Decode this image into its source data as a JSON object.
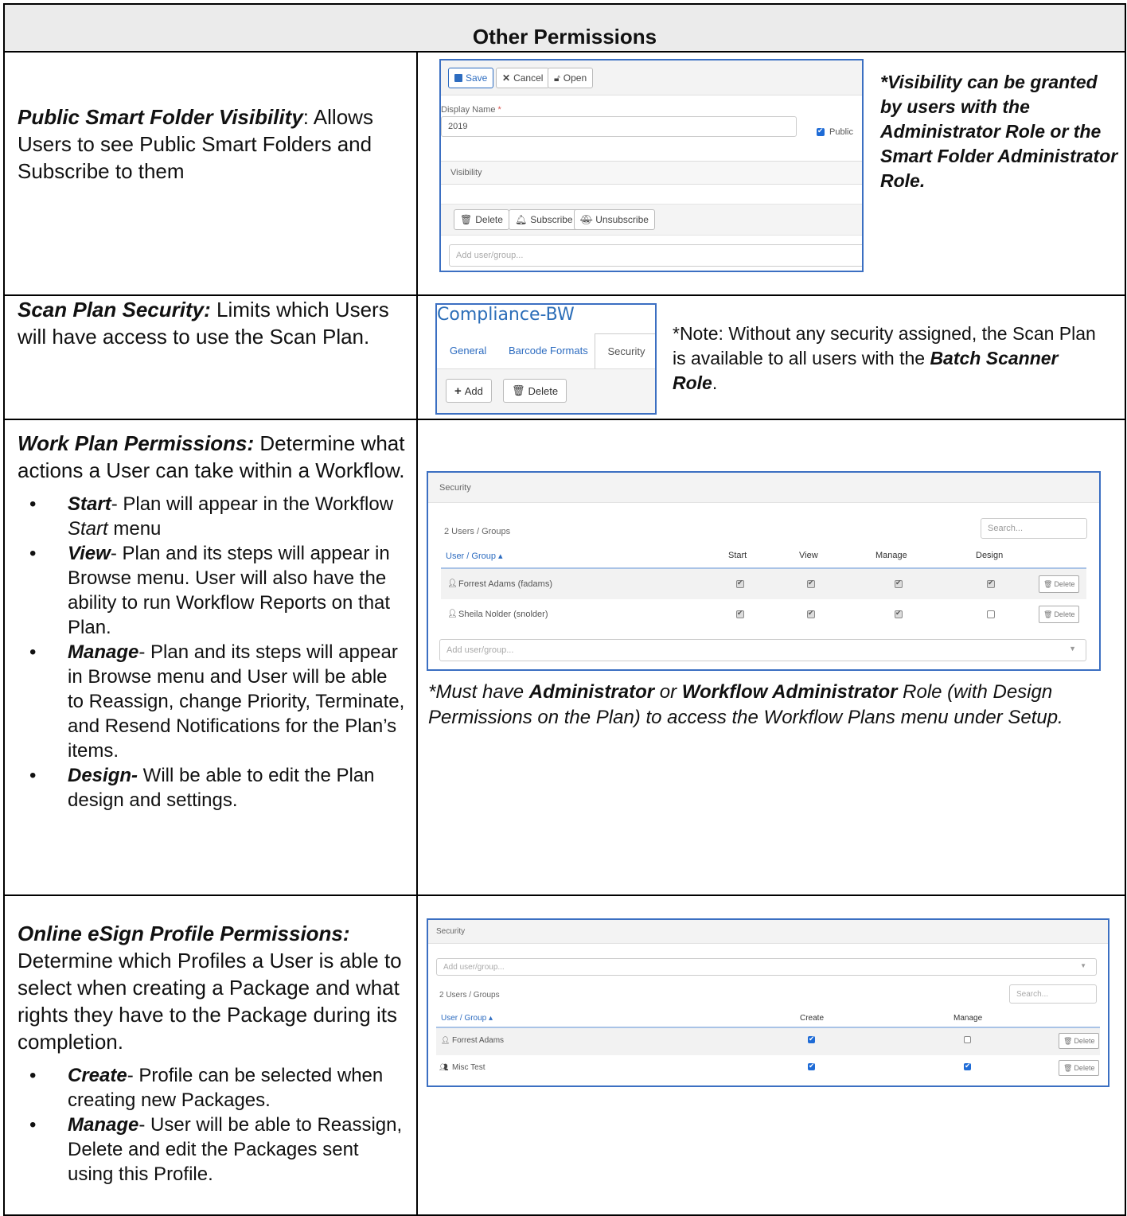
{
  "header": {
    "title": "Other Permissions"
  },
  "row1": {
    "title": "Public Smart Folder Visibility",
    "desc": ": Allows Users to see Public Smart Folders and Subscribe to them",
    "note": "*Visibility can be granted by users with the Administrator Role or the Smart Folder Administrator Role.",
    "shot": {
      "save": "Save",
      "cancel": "Cancel",
      "open": "Open",
      "display_name_label": "Display Name",
      "required_mark": "*",
      "display_name_value": "2019",
      "public_label": "Public",
      "visibility_label": "Visibility",
      "delete": "Delete",
      "subscribe": "Subscribe",
      "unsubscribe": "Unsubscribe",
      "add_placeholder": "Add user/group..."
    }
  },
  "row2": {
    "title": "Scan Plan Security:",
    "desc": " Limits which Users will have access to use the Scan Plan.",
    "note_pre": "*Note:  Without any security assigned, the Scan Plan is available to all users with the ",
    "note_bold": "Batch Scanner Role",
    "note_post": ".",
    "shot": {
      "title": "Compliance-BW",
      "tabs": [
        "General",
        "Barcode Formats",
        "Security"
      ],
      "add": "Add",
      "delete": "Delete"
    }
  },
  "row3": {
    "title": "Work Plan Permissions:",
    "desc": " Determine what actions a User can take within a Workflow.",
    "bullets": [
      {
        "term": "Start",
        "text_a": "- Plan will appear in the Workflow ",
        "text_it": "Start",
        "text_b": " menu"
      },
      {
        "term": "View",
        "text_a": "- Plan and its steps will appear in Browse menu.  User will also have the ability to run Workflow Reports on that Plan.",
        "text_it": "",
        "text_b": ""
      },
      {
        "term": "Manage",
        "text_a": "- Plan and its steps will appear in Browse menu and User will be able to Reassign, change Priority, Terminate, and Resend Notifications  for the Plan’s items.",
        "text_it": "",
        "text_b": ""
      },
      {
        "term": "Design-",
        "text_a": " Will be able to edit the Plan design and settings.",
        "text_it": "",
        "text_b": ""
      }
    ],
    "note_a": "*Must have ",
    "note_b1": "Administrator",
    "note_c": " or ",
    "note_b2": "Workflow Administrator",
    "note_d": " Role (with Design Permissions on the Plan) to access the Workflow Plans menu under Setup.",
    "shot": {
      "security": "Security",
      "count": "2 Users / Groups",
      "search": "Search...",
      "col_user": "User / Group",
      "sort_mark": "▴",
      "cols": [
        "Start",
        "View",
        "Manage",
        "Design"
      ],
      "rows": [
        {
          "name": "Forrest Adams (fadams)",
          "checks": [
            true,
            true,
            true,
            true
          ]
        },
        {
          "name": "Sheila Nolder (snolder)",
          "checks": [
            true,
            true,
            true,
            false
          ]
        }
      ],
      "delete": "Delete",
      "add_placeholder": "Add user/group..."
    }
  },
  "row4": {
    "title": "Online eSign Profile Permissions:",
    "desc": "Determine which Profiles a User is able to select when creating a Package and what rights they have to the Package during its completion.",
    "bullets": [
      {
        "term": "Create",
        "text": "- Profile can be selected when creating new Packages."
      },
      {
        "term": "Manage",
        "text": "- User will be able to Reassign, Delete and edit the Packages sent using this Profile."
      }
    ],
    "shot": {
      "security": "Security",
      "add_placeholder": "Add user/group...",
      "count": "2 Users / Groups",
      "search": "Search...",
      "col_user": "User / Group",
      "sort_mark": "▴",
      "cols": [
        "Create",
        "Manage"
      ],
      "rows": [
        {
          "name": "Forrest Adams",
          "icon": "user-icon",
          "checks": [
            true,
            false
          ]
        },
        {
          "name": "Misc Test",
          "icon": "group-icon",
          "checks": [
            true,
            true
          ]
        }
      ],
      "delete": "Delete"
    }
  }
}
